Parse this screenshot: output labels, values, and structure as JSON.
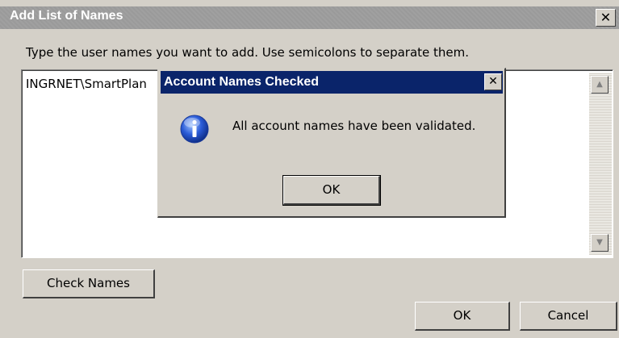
{
  "outer_dialog": {
    "title": "Add List of Names",
    "close_glyph": "✕",
    "instruction": "Type the user names you want to add. Use semicolons to separate them.",
    "names_value": "INGRNET\\SmartPlan",
    "check_names_label": "Check Names",
    "ok_label": "OK",
    "cancel_label": "Cancel",
    "scroll_up_glyph": "▲",
    "scroll_down_glyph": "▼"
  },
  "message_box": {
    "title": "Account Names Checked",
    "close_glyph": "✕",
    "icon": "info-icon",
    "message": "All account names have been validated.",
    "ok_label": "OK"
  },
  "colors": {
    "dialog_bg": "#d4d0c8",
    "active_title": "#0a246a",
    "inactive_title": "#9a9a9a",
    "info_icon": "#2a5bd7"
  }
}
